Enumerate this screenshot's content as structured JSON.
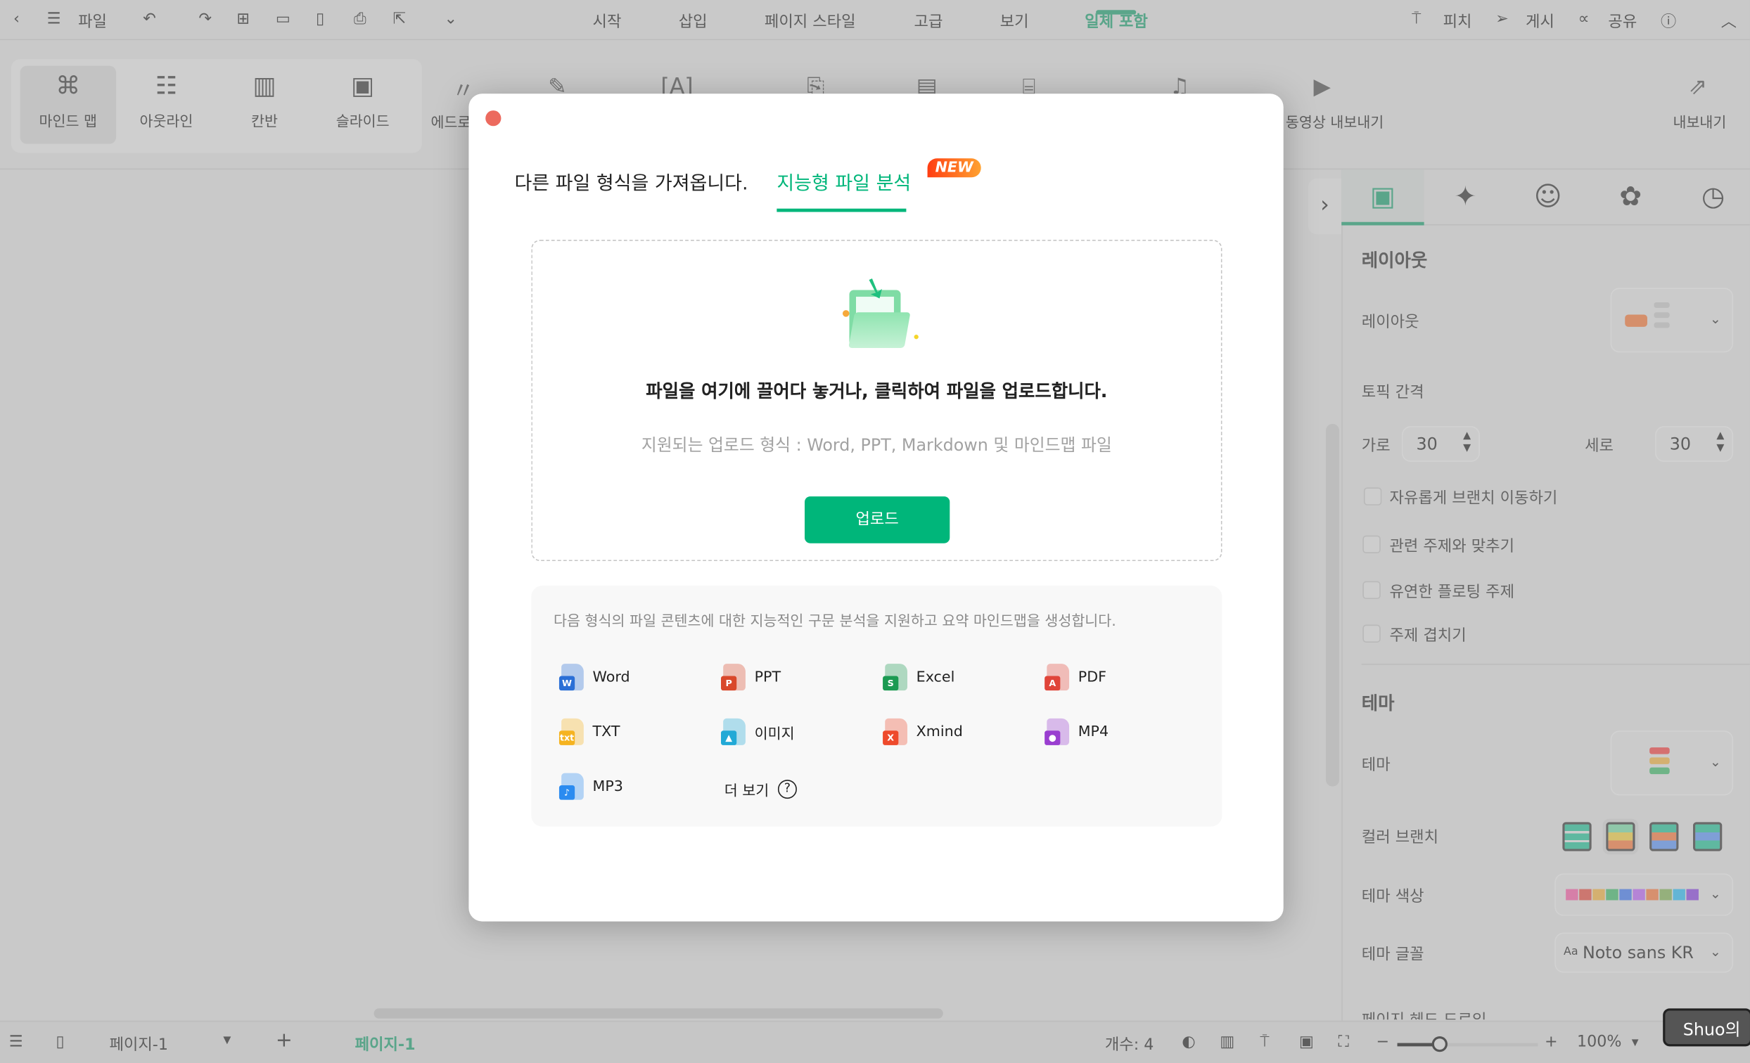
{
  "menubar": {
    "file": "파일",
    "tabs": [
      "시작",
      "삽입",
      "페이지 스타일",
      "고급",
      "보기",
      "일체 포함"
    ],
    "active_tab": "일체 포함",
    "right": {
      "pitch": "피치",
      "publish": "게시",
      "share": "공유"
    }
  },
  "ribbon": {
    "views": [
      "마인드 맵",
      "아웃라인",
      "칸반",
      "슬라이드"
    ],
    "partial": "에드로",
    "video_export": "동영상 내보내기",
    "export": "내보내기"
  },
  "panel": {
    "layout_section": "레이아웃",
    "layout_label": "레이아웃",
    "topic_spacing": "토픽 간격",
    "horizontal_label": "가로",
    "horizontal_value": "30",
    "vertical_label": "세로",
    "vertical_value": "30",
    "checkboxes": [
      "자유롭게 브랜치 이동하기",
      "관련 주제와 맞추기",
      "유연한 플로팅 주제",
      "주제 겹치기"
    ],
    "theme_section": "테마",
    "theme_label": "테마",
    "color_branch": "컬러 브랜치",
    "theme_color": "테마 색상",
    "theme_font": "테마 글꼴",
    "font_value": "Noto sans KR",
    "font_prefix": "Aa",
    "cut_label": "페이지 헤드 드로잉",
    "palette": [
      "#d67fa8",
      "#cc7770",
      "#d4b070",
      "#6fb487",
      "#6f8fd3",
      "#b584d6",
      "#d7906e",
      "#95b07c",
      "#63b5d5",
      "#9870c9"
    ]
  },
  "status": {
    "page_select": "페이지-1",
    "page_tab": "페이지-1",
    "count": "개수: 4",
    "zoom": "100%",
    "zoom_fraction": 0.3,
    "tooltip": "Shuo의"
  },
  "dialog": {
    "tab_import": "다른 파일 형식을 가져옵니다.",
    "tab_smart": "지능형 파일 분석",
    "new_badge": "NEW",
    "drop_title": "파일을 여기에 끌어다 놓거나, 클릭하여 파일을 업로드합니다.",
    "drop_sub": "지원되는 업로드 형식 : Word, PPT, Markdown 및 마인드맵 파일",
    "upload": "업로드",
    "info_text": "다음 형식의 파일 콘텐츠에 대한 지능적인 구문 분석을 지원하고 요약 마인드맵을 생성합니다.",
    "formats": [
      {
        "name": "Word",
        "color": "#2b6fd6",
        "glyph": "W"
      },
      {
        "name": "PPT",
        "color": "#d9482b",
        "glyph": "P"
      },
      {
        "name": "Excel",
        "color": "#1b9a52",
        "glyph": "S"
      },
      {
        "name": "PDF",
        "color": "#e0453a",
        "glyph": "A"
      },
      {
        "name": "TXT",
        "color": "#f5b320",
        "glyph": "txt"
      },
      {
        "name": "이미지",
        "color": "#22a9d6",
        "glyph": "▲"
      },
      {
        "name": "Xmind",
        "color": "#ee4a2c",
        "glyph": "X"
      },
      {
        "name": "MP4",
        "color": "#9a3fd0",
        "glyph": "●"
      },
      {
        "name": "MP3",
        "color": "#2b8bf0",
        "glyph": "♪"
      }
    ],
    "more": "더 보기",
    "accent": "#00b67a"
  }
}
